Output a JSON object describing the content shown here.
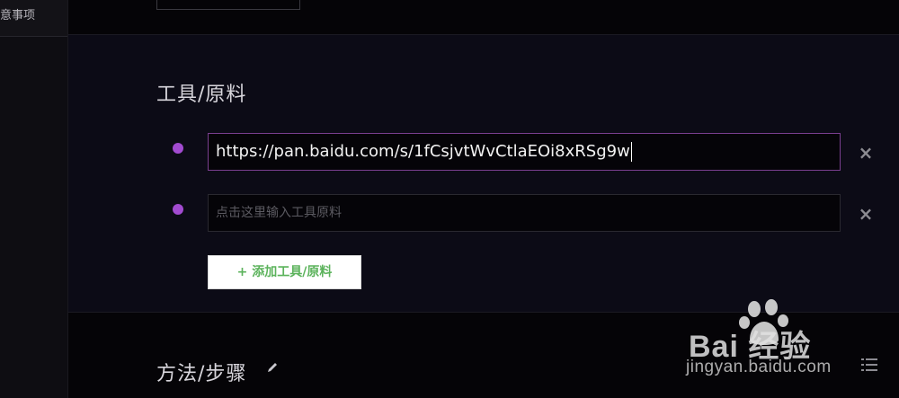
{
  "sidebar": {
    "item_label": "意事项"
  },
  "tools": {
    "title": "工具/原料",
    "items": [
      {
        "value": "https://pan.baidu.com/s/1fCsjvtWvCtlaEOi8xRSg9w"
      },
      {
        "placeholder": "点击这里输入工具原料"
      }
    ],
    "add_button_label": "+ 添加工具/原料"
  },
  "steps": {
    "title": "方法/步骤"
  },
  "watermark": {
    "brand": "Bai 经验",
    "url": "jingyan.baidu.com"
  },
  "colors": {
    "accent": "#a24bd0",
    "add_button_text": "#5cb35c",
    "active_border": "#7a3f8f"
  },
  "icons": [
    "close-icon",
    "pencil-icon",
    "list-icon",
    "paw-icon"
  ]
}
